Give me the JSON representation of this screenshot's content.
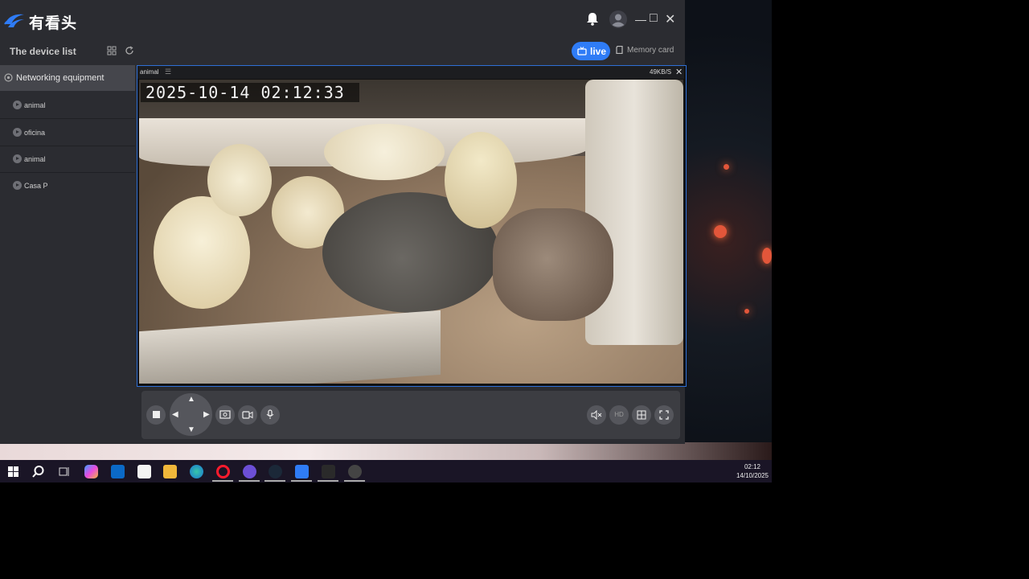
{
  "app": {
    "brand": "有看头",
    "device_list_title": "The device list",
    "live_label": "live",
    "memory_label": "Memory card"
  },
  "sidebar": {
    "group": "Networking equipment",
    "items": [
      {
        "label": "animal"
      },
      {
        "label": "oficina"
      },
      {
        "label": "animal"
      },
      {
        "label": "Casa P"
      }
    ]
  },
  "video": {
    "channel_name": "animal",
    "bitrate": "49KB/S",
    "osd_timestamp": "2025-10-14  02:12:33"
  },
  "controls": {
    "hd_label": "HD"
  },
  "taskbar": {
    "time": "02:12",
    "date": "14/10/2025"
  },
  "colors": {
    "accent": "#2f7cf6",
    "panel": "#2b2c31",
    "taskbar": "#1a1526"
  }
}
